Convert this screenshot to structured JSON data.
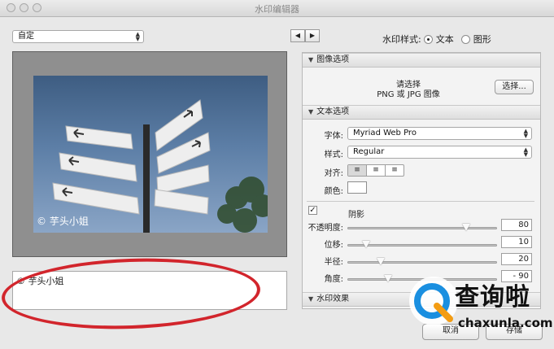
{
  "window": {
    "title": "水印编辑器"
  },
  "preset": {
    "selected": "自定"
  },
  "nav": {
    "prev": "◀",
    "next": "▶"
  },
  "watermark_style": {
    "label": "水印样式:",
    "text_option": "文本",
    "image_option": "图形",
    "selected": "text"
  },
  "preview": {
    "watermark_text": "© 芋头小姐"
  },
  "text_input": {
    "value": "© 芋头小姐"
  },
  "image_options": {
    "header": "图像选项",
    "prompt_line1": "请选择",
    "prompt_line2": "PNG 或 JPG 图像",
    "choose_button": "选择..."
  },
  "text_options": {
    "header": "文本选项",
    "font_label": "字体:",
    "font_value": "Myriad Web Pro",
    "style_label": "样式:",
    "style_value": "Regular",
    "align_label": "对齐:",
    "color_label": "颜色:"
  },
  "shadow": {
    "label": "阴影",
    "checked": true,
    "opacity_label": "不透明度:",
    "opacity_value": "80",
    "offset_label": "位移:",
    "offset_value": "10",
    "radius_label": "半径:",
    "radius_value": "20",
    "angle_label": "角度:",
    "angle_value": "- 90"
  },
  "watermark_effects": {
    "header": "水印效果"
  },
  "footer": {
    "cancel_label": "取消",
    "save_label": "存储"
  },
  "overlay_logo": {
    "name": "查询啦",
    "url": "chaxunla.com"
  },
  "colors": {
    "annotation_red": "#d2252c",
    "logo_blue": "#1a8fe0",
    "logo_orange": "#f39c12"
  }
}
